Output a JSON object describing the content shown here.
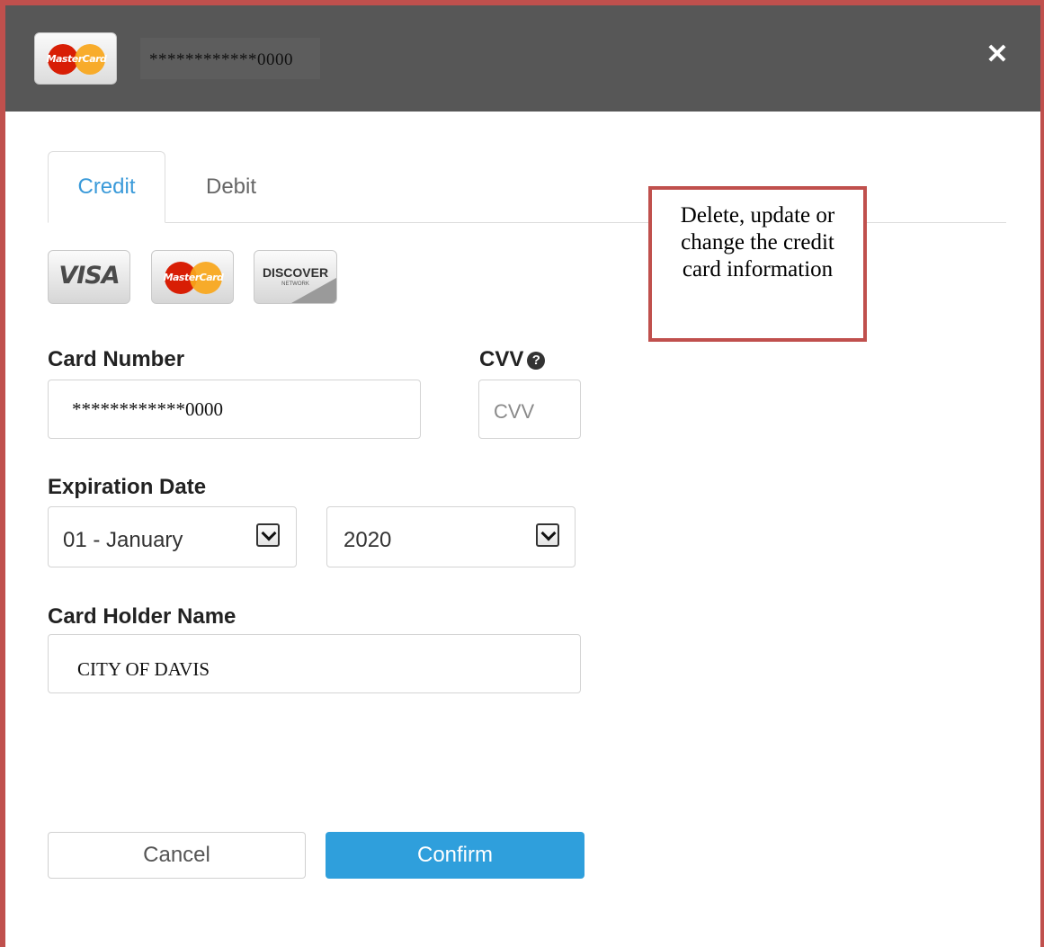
{
  "header": {
    "card_brand": "MasterCard",
    "masked_number": "************0000",
    "close_label": "✕"
  },
  "tabs": [
    {
      "label": "Credit",
      "active": true
    },
    {
      "label": "Debit",
      "active": false
    }
  ],
  "card_logos": {
    "visa": "VISA",
    "mastercard": "MasterCard",
    "discover": "DISCOVER",
    "discover_sub": "NETWORK"
  },
  "form": {
    "card_number_label": "Card Number",
    "card_number_value": "************0000",
    "cvv_label": "CVV",
    "cvv_help_icon": "?",
    "cvv_placeholder": "CVV",
    "expiration_label": "Expiration Date",
    "exp_month": "01 - January",
    "exp_year": "2020",
    "holder_label": "Card Holder Name",
    "holder_value": "CITY OF DAVIS"
  },
  "buttons": {
    "cancel": "Cancel",
    "confirm": "Confirm"
  },
  "annotation": "Delete, update or change the credit card information",
  "colors": {
    "accent": "#2f9fdc",
    "header_bg": "#575757",
    "annotation_border": "#c0504d"
  }
}
